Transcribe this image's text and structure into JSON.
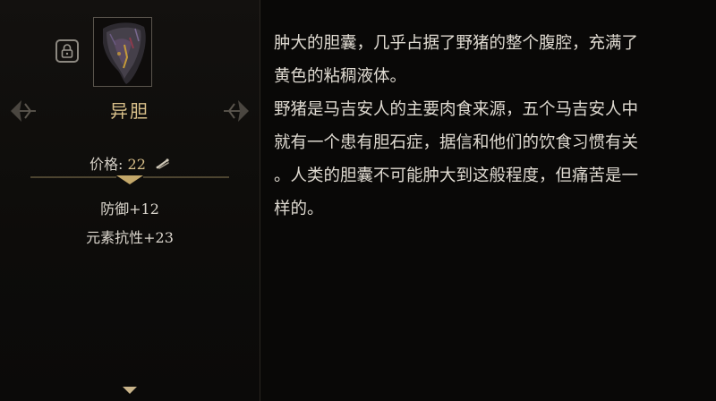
{
  "item": {
    "name": "异胆",
    "icon": "gallbladder-item-icon",
    "lock_icon": "lock-icon"
  },
  "price": {
    "label": "价格:",
    "value": "22",
    "currency_icon": "bone-currency-icon"
  },
  "stats": [
    "防御+12",
    "元素抗性+23"
  ],
  "description": [
    "肿大的胆囊，几乎占据了野猪的整个腹腔，充满了",
    "黄色的粘稠液体。",
    "野猪是马吉安人的主要肉食来源，五个马吉安人中",
    "就有一个患有胆石症，据信和他们的饮食习惯有关",
    "。人类的胆囊不可能肿大到这般程度，但痛苦是一",
    "样的。"
  ],
  "colors": {
    "accent_gold": "#d9c08a",
    "background": "#090807"
  }
}
